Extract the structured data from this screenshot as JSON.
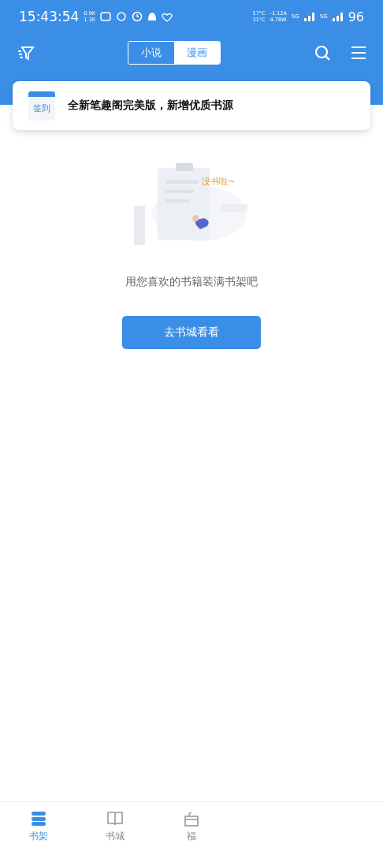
{
  "status_bar": {
    "time": "15:43:54",
    "net_up": "0.9K",
    "net_down": "1.3K",
    "temp_1": "57°C",
    "temp_2": "31°C",
    "current": "-1.12A",
    "power": "4.78W",
    "signal_1": "5G",
    "signal_2": "5G",
    "battery": "96"
  },
  "header": {
    "tabs": [
      {
        "label": "小说",
        "selected": true
      },
      {
        "label": "漫画",
        "selected": false
      }
    ]
  },
  "notice": {
    "icon_label": "签到",
    "text": "全新笔趣阁完美版，新增优质书源"
  },
  "empty_state": {
    "illustration_caption": "没书啦~",
    "message": "用您喜欢的书籍装满书架吧",
    "button": "去书城看看"
  },
  "bottom_nav": [
    {
      "label": "书架",
      "selected": true,
      "kind": "shelf"
    },
    {
      "label": "书城",
      "selected": false,
      "kind": "store"
    },
    {
      "label": "福",
      "selected": false,
      "kind": "gift"
    }
  ]
}
